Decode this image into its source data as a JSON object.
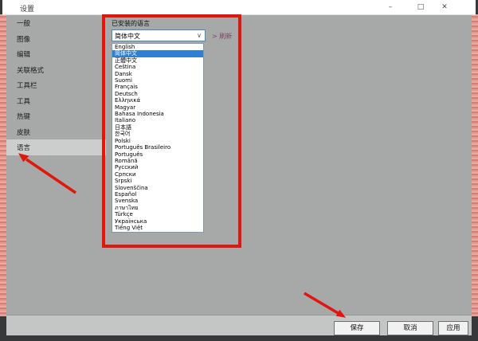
{
  "window": {
    "title": "设置",
    "controls": {
      "minimize": "–",
      "maximize": "□",
      "close": "✕"
    }
  },
  "sidebar": {
    "items": [
      {
        "label": "一般",
        "selected": false
      },
      {
        "label": "图像",
        "selected": false
      },
      {
        "label": "编辑",
        "selected": false
      },
      {
        "label": "关联格式",
        "selected": false
      },
      {
        "label": "工具栏",
        "selected": false
      },
      {
        "label": "工具",
        "selected": false
      },
      {
        "label": "热键",
        "selected": false
      },
      {
        "label": "皮肤",
        "selected": false
      },
      {
        "label": "语言",
        "selected": true
      }
    ]
  },
  "language_panel": {
    "section_label": "已安装的语言",
    "combobox": {
      "value": "简体中文",
      "chevron": "∨"
    },
    "refresh_link": "> 刷新",
    "language_list": {
      "items": [
        {
          "label": "English",
          "selected": false
        },
        {
          "label": "简体中文",
          "selected": true
        },
        {
          "label": "正體中文",
          "selected": false
        },
        {
          "label": "Čeština",
          "selected": false
        },
        {
          "label": "Dansk",
          "selected": false
        },
        {
          "label": "Suomi",
          "selected": false
        },
        {
          "label": "Français",
          "selected": false
        },
        {
          "label": "Deutsch",
          "selected": false
        },
        {
          "label": "Ελληνικά",
          "selected": false
        },
        {
          "label": "Magyar",
          "selected": false
        },
        {
          "label": "Bahasa Indonesia",
          "selected": false
        },
        {
          "label": "Italiano",
          "selected": false
        },
        {
          "label": "日本語",
          "selected": false
        },
        {
          "label": "한국어",
          "selected": false
        },
        {
          "label": "Polski",
          "selected": false
        },
        {
          "label": "Português Brasileiro",
          "selected": false
        },
        {
          "label": "Português",
          "selected": false
        },
        {
          "label": "Română",
          "selected": false
        },
        {
          "label": "Русский",
          "selected": false
        },
        {
          "label": "Српски",
          "selected": false
        },
        {
          "label": "Srpski",
          "selected": false
        },
        {
          "label": "Slovenščina",
          "selected": false
        },
        {
          "label": "Español",
          "selected": false
        },
        {
          "label": "Svenska",
          "selected": false
        },
        {
          "label": "ภาษาไทย",
          "selected": false
        },
        {
          "label": "Türkçe",
          "selected": false
        },
        {
          "label": "Українська",
          "selected": false
        },
        {
          "label": "Tiếng Việt",
          "selected": false
        }
      ]
    }
  },
  "footer": {
    "buttons": {
      "save": "保存",
      "cancel": "取消",
      "apply": "应用"
    }
  },
  "colors": {
    "annotation_red": "#e1160f",
    "selection_blue": "#2f7fd4",
    "panel_gray": "#a6a9a8",
    "sidebar_selected_gray": "#cbcecd",
    "titlebar_white": "#ffffff",
    "refresh_link_color": "#7d4560",
    "background_pink": "#eba9a2"
  }
}
